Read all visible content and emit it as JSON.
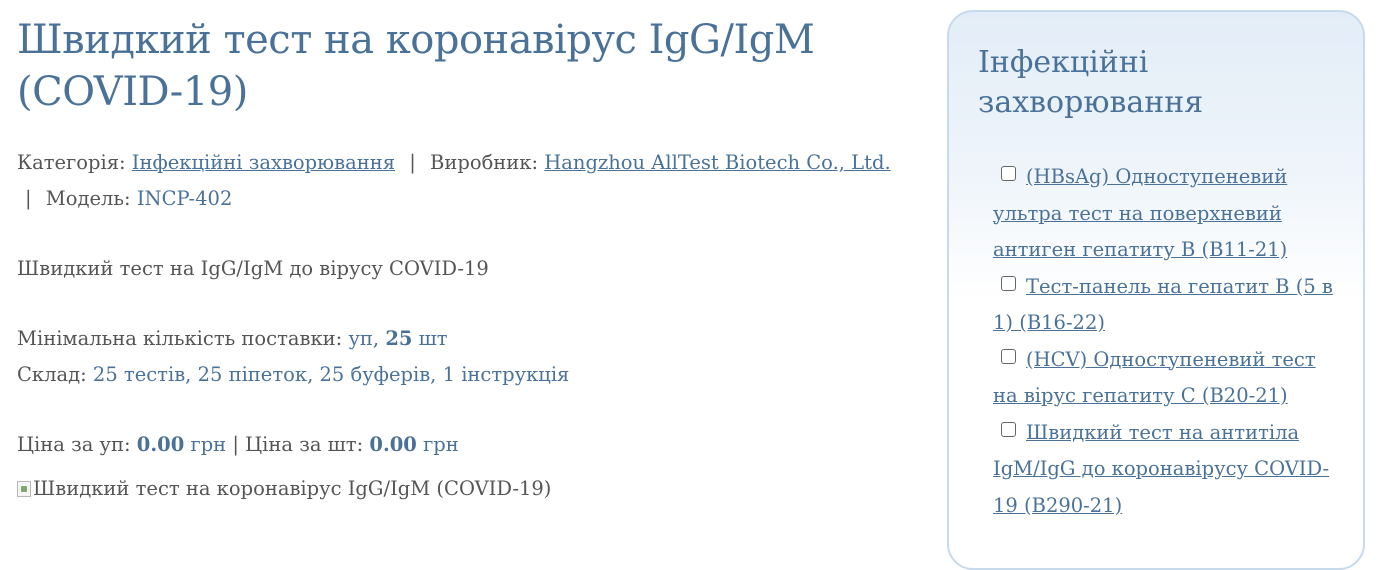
{
  "product": {
    "title": "Швидкий тест на коронавірус IgG/IgM (COVID-19)",
    "category_label": "Категорія:",
    "category_value": "Інфекційні захворювання",
    "manufacturer_label": "Виробник:",
    "manufacturer_value": "Hangzhou AllTest Biotech Co., Ltd.",
    "model_label": "Модель:",
    "model_value": "INCP-402",
    "separator": "|",
    "description": "Швидкий тест на IgG/IgM до вірусу COVID-19",
    "min_qty_label": "Мінімальна кількість поставки:",
    "min_qty_unit": "уп,",
    "min_qty_count": "25",
    "min_qty_count_unit": "шт",
    "composition_label": "Склад:",
    "composition_value": "25 тестів, 25 піпеток, 25 буферів, 1 інструкція",
    "price_pack_label": "Ціна за уп:",
    "price_pack_value": "0.00",
    "price_currency": "грн",
    "price_piece_label": "| Ціна за шт:",
    "price_piece_value": "0.00",
    "image_alt": "Швидкий тест на коронавірус IgG/IgM (COVID-19)"
  },
  "sidebar": {
    "title": "Інфекційні захворювання",
    "items": [
      {
        "label": "(HBsAg)  Одноступеневий ультра тест на поверхневий антиген гепатиту В (В11-21)",
        "checked": false
      },
      {
        "label": "Тест-панель на гепатит В (5 в 1) (В16-22)",
        "checked": false
      },
      {
        "label": "(HCV) Одноступеневий тест на вірус гепатиту С (В20-21)",
        "checked": false
      },
      {
        "label": "Швидкий тест на антитіла IgM/IgG до коронавірусу COVID-19 (В290-21)",
        "checked": false
      }
    ]
  },
  "colors": {
    "accent": "#4a7299",
    "text": "#555555",
    "sidebar_border": "#c7daec"
  }
}
